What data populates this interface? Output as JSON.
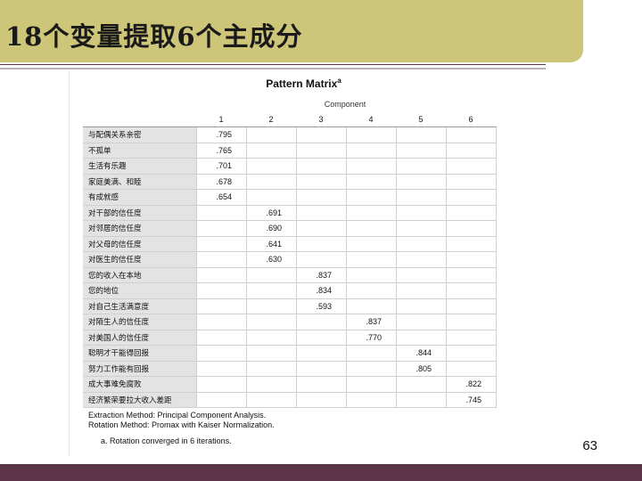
{
  "slide": {
    "title": "18个变量提取6个主成分",
    "page_number": "63"
  },
  "matrix": {
    "title": "Pattern Matrix",
    "title_superscript": "a",
    "component_label": "Component",
    "columns": [
      "1",
      "2",
      "3",
      "4",
      "5",
      "6"
    ],
    "rows": [
      {
        "label": "与配偶关系亲密",
        "values": [
          ".795",
          "",
          "",
          "",
          "",
          ""
        ]
      },
      {
        "label": "不孤单",
        "values": [
          ".765",
          "",
          "",
          "",
          "",
          ""
        ]
      },
      {
        "label": "生活有乐趣",
        "values": [
          ".701",
          "",
          "",
          "",
          "",
          ""
        ]
      },
      {
        "label": "家庭美满、和睦",
        "values": [
          ".678",
          "",
          "",
          "",
          "",
          ""
        ]
      },
      {
        "label": "有成就感",
        "values": [
          ".654",
          "",
          "",
          "",
          "",
          ""
        ]
      },
      {
        "label": "对干部的信任度",
        "values": [
          "",
          ".691",
          "",
          "",
          "",
          ""
        ]
      },
      {
        "label": "对邻居的信任度",
        "values": [
          "",
          ".690",
          "",
          "",
          "",
          ""
        ]
      },
      {
        "label": "对父母的信任度",
        "values": [
          "",
          ".641",
          "",
          "",
          "",
          ""
        ]
      },
      {
        "label": "对医生的信任度",
        "values": [
          "",
          ".630",
          "",
          "",
          "",
          ""
        ]
      },
      {
        "label": "您的收入在本地",
        "values": [
          "",
          "",
          ".837",
          "",
          "",
          ""
        ]
      },
      {
        "label": "您的地位",
        "values": [
          "",
          "",
          ".834",
          "",
          "",
          ""
        ]
      },
      {
        "label": "对自己生活满意度",
        "values": [
          "",
          "",
          ".593",
          "",
          "",
          ""
        ]
      },
      {
        "label": "对陌生人的信任度",
        "values": [
          "",
          "",
          "",
          ".837",
          "",
          ""
        ]
      },
      {
        "label": "对美国人的信任度",
        "values": [
          "",
          "",
          "",
          ".770",
          "",
          ""
        ]
      },
      {
        "label": "聪明才干能得回报",
        "values": [
          "",
          "",
          "",
          "",
          ".844",
          ""
        ]
      },
      {
        "label": "努力工作能有回报",
        "values": [
          "",
          "",
          "",
          "",
          ".805",
          ""
        ]
      },
      {
        "label": "成大事难免腐败",
        "values": [
          "",
          "",
          "",
          "",
          "",
          ".822"
        ]
      },
      {
        "label": "经济繁荣要拉大收入差距",
        "values": [
          "",
          "",
          "",
          "",
          "",
          ".745"
        ]
      }
    ],
    "notes": {
      "extraction": "Extraction Method: Principal Component Analysis.",
      "rotation": "Rotation Method: Promax with Kaiser Normalization.",
      "footnote": "a. Rotation converged in 6 iterations."
    }
  }
}
